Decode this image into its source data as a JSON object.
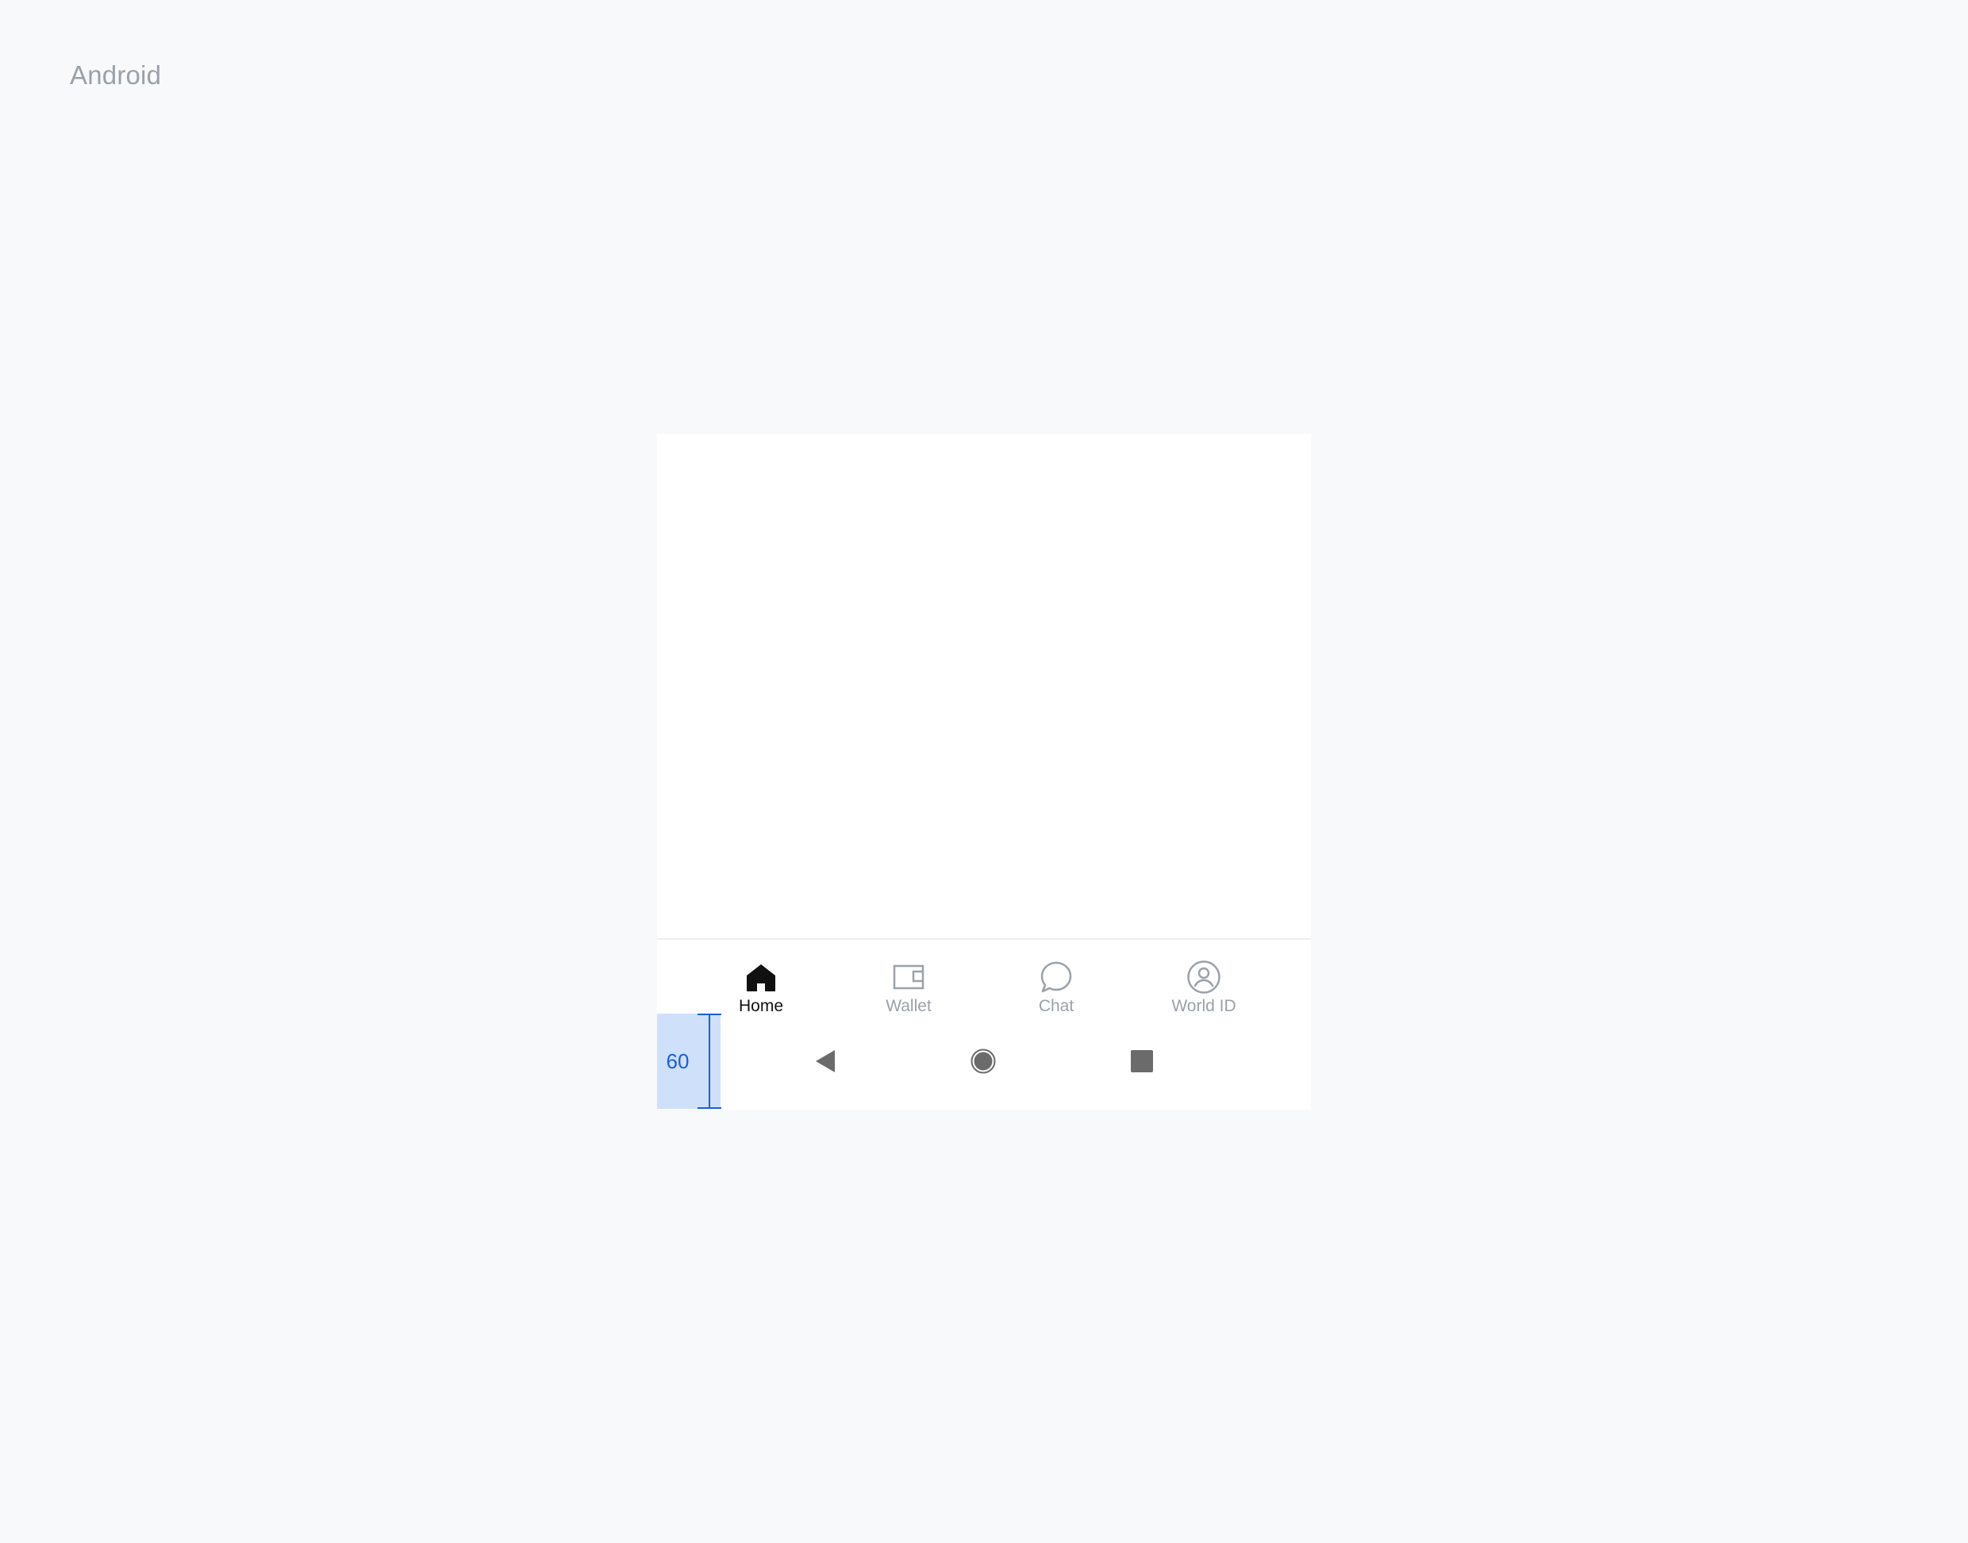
{
  "platform_label": "Android",
  "tabs": [
    {
      "label": "Home",
      "icon": "home-icon",
      "active": true
    },
    {
      "label": "Wallet",
      "icon": "wallet-icon",
      "active": false
    },
    {
      "label": "Chat",
      "icon": "chat-icon",
      "active": false
    },
    {
      "label": "World ID",
      "icon": "world-id-icon",
      "active": false
    }
  ],
  "system_nav": {
    "back_icon": "back-triangle-icon",
    "home_icon": "home-circle-icon",
    "recents_icon": "recents-square-icon"
  },
  "measurement": {
    "value": "60"
  },
  "colors": {
    "active_tab": "#111111",
    "inactive_tab": "#9aa1aa",
    "measurement_accent": "#1a5fd6",
    "measurement_fill": "#cfe0fb",
    "system_nav_icon": "#6b6b6b"
  }
}
